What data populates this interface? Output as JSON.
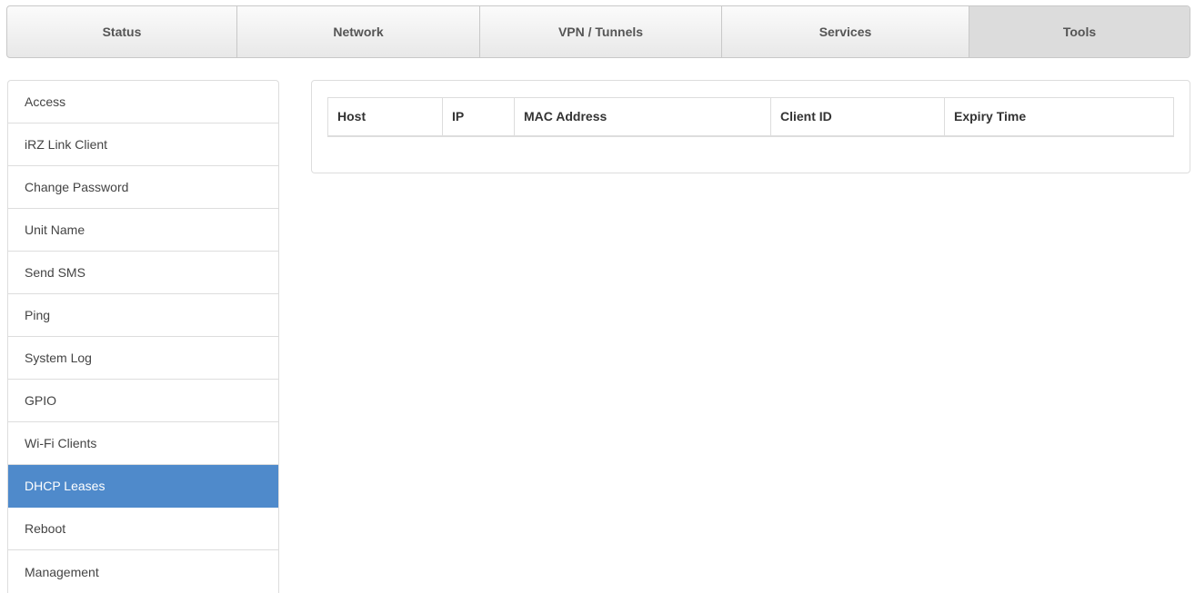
{
  "topnav": {
    "tabs": [
      {
        "label": "Status",
        "active": false
      },
      {
        "label": "Network",
        "active": false
      },
      {
        "label": "VPN / Tunnels",
        "active": false
      },
      {
        "label": "Services",
        "active": false
      },
      {
        "label": "Tools",
        "active": true
      }
    ]
  },
  "sidebar": {
    "items": [
      {
        "label": "Access"
      },
      {
        "label": "iRZ Link Client"
      },
      {
        "label": "Change Password"
      },
      {
        "label": "Unit Name"
      },
      {
        "label": "Send SMS"
      },
      {
        "label": "Ping"
      },
      {
        "label": "System Log"
      },
      {
        "label": "GPIO"
      },
      {
        "label": "Wi-Fi Clients"
      },
      {
        "label": "DHCP Leases",
        "active": true
      },
      {
        "label": "Reboot"
      },
      {
        "label": "Management"
      }
    ]
  },
  "leases_table": {
    "columns": [
      "Host",
      "IP",
      "MAC Address",
      "Client ID",
      "Expiry Time"
    ],
    "rows": []
  },
  "colors": {
    "active_sidebar": "#4f8acb",
    "active_tab": "#dcdcdc",
    "border": "#dddddd"
  }
}
